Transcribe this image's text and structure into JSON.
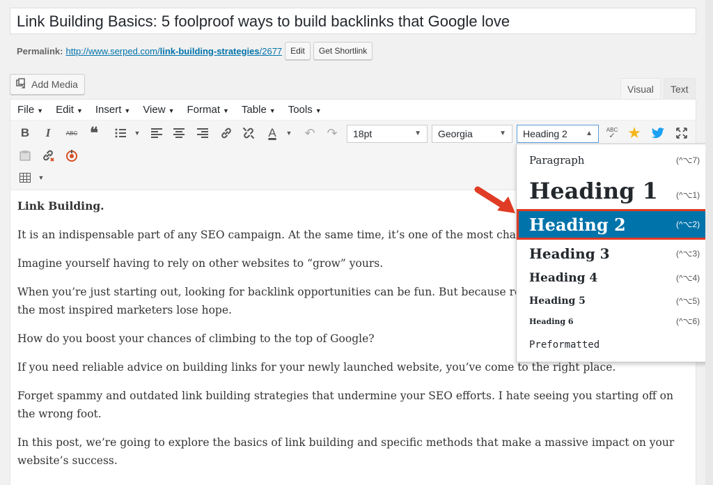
{
  "post": {
    "title": "Link Building Basics: 5 foolproof ways to build backlinks that Google love"
  },
  "permalink": {
    "label": "Permalink:",
    "url_base": "http://www.serped.com/",
    "url_slug": "link-building-strategies",
    "url_id": "/2677",
    "edit_label": "Edit",
    "shortlink_label": "Get Shortlink"
  },
  "media": {
    "add_label": "Add Media"
  },
  "tabs": {
    "visual": "Visual",
    "text": "Text"
  },
  "menubar": [
    "File",
    "Edit",
    "Insert",
    "View",
    "Format",
    "Table",
    "Tools"
  ],
  "toolbar": {
    "font_size": "18pt",
    "font_family": "Georgia",
    "block_format": "Heading 2",
    "spellcheck_label": "ABC",
    "strike_label": "ABC"
  },
  "dropdown": {
    "items": [
      {
        "label": "Paragraph",
        "shortcut": "(^⌥7)"
      },
      {
        "label": "Heading 1",
        "shortcut": "(^⌥1)"
      },
      {
        "label": "Heading 2",
        "shortcut": "(^⌥2)"
      },
      {
        "label": "Heading 3",
        "shortcut": "(^⌥3)"
      },
      {
        "label": "Heading 4",
        "shortcut": "(^⌥4)"
      },
      {
        "label": "Heading 5",
        "shortcut": "(^⌥5)"
      },
      {
        "label": "Heading 6",
        "shortcut": "(^⌥6)"
      },
      {
        "label": "Preformatted",
        "shortcut": ""
      }
    ],
    "selected": "Heading 2"
  },
  "content": {
    "lead": "Link Building.",
    "p1": "It is an indispensable part of any SEO campaign. At the same time, it’s one of the most challengin",
    "p2": "Imagine yourself having to rely on other websites to “grow” yours.",
    "p3": "When you’re just starting out, looking for backlink opportunities can be fun. But because real res",
    "p3b": "the most inspired marketers lose hope.",
    "p4": "How do you boost your chances of climbing to the top of Google?",
    "p5": "If you need reliable advice on building links for your newly launched website, you’ve come to the right place.",
    "p6": "Forget spammy and outdated link building strategies that undermine your SEO efforts. I hate seeing you starting off on the wrong foot.",
    "p7": "In this post, we’re going to explore the basics of link building and specific methods that make a massive impact on your website’s success."
  },
  "colors": {
    "accent": "#0073aa",
    "highlight_border": "#e03b24",
    "star": "#f6b619",
    "twitter": "#1da1f2",
    "link_break": "#d54e21"
  }
}
